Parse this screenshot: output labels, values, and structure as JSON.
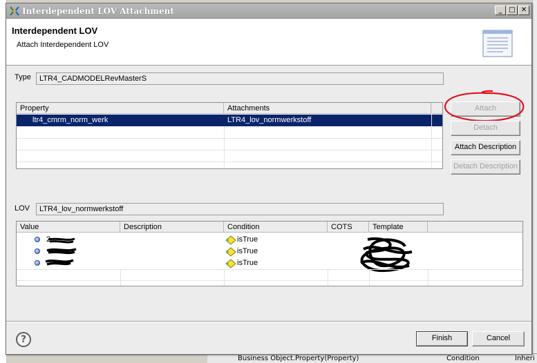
{
  "window": {
    "title": "Interdependent LOV Attachment",
    "minimize_glyph": "_",
    "maximize_glyph": "□",
    "close_glyph": "✕"
  },
  "header": {
    "title": "Interdependent LOV",
    "subtitle": "Attach Interdependent LOV"
  },
  "type_section": {
    "label": "Type",
    "value": "LTR4_CADMODELRevMasterS"
  },
  "property_table": {
    "columns": [
      "Property",
      "Attachments"
    ],
    "rows": [
      {
        "property": "ltr4_cmrm_norm_werk",
        "attachment": "LTR4_lov_normwerkstoff",
        "selected": true
      }
    ]
  },
  "side_buttons": {
    "attach": "Attach",
    "detach": "Detach",
    "attach_description": "Attach Description",
    "detach_description": "Detach Description"
  },
  "lov_section": {
    "label": "LOV",
    "value": "LTR4_lov_normwerkstoff"
  },
  "lov_table": {
    "columns": [
      "Value",
      "Description",
      "Condition",
      "COTS",
      "Template"
    ],
    "rows": [
      {
        "value": "2",
        "condition": "isTrue"
      },
      {
        "value": "",
        "condition": "isTrue"
      },
      {
        "value": "",
        "condition": "isTrue"
      }
    ]
  },
  "footer": {
    "help_glyph": "?",
    "finish": "Finish",
    "cancel": "Cancel"
  },
  "background": {
    "bottom_text": "Business Object.Property(Property)",
    "bottom_col2": "Condition",
    "bottom_col3": "Inheri"
  },
  "colors": {
    "selection": "#0a246a",
    "annotation_circle": "#e0101e",
    "titlebar": "#a8a8a8"
  }
}
